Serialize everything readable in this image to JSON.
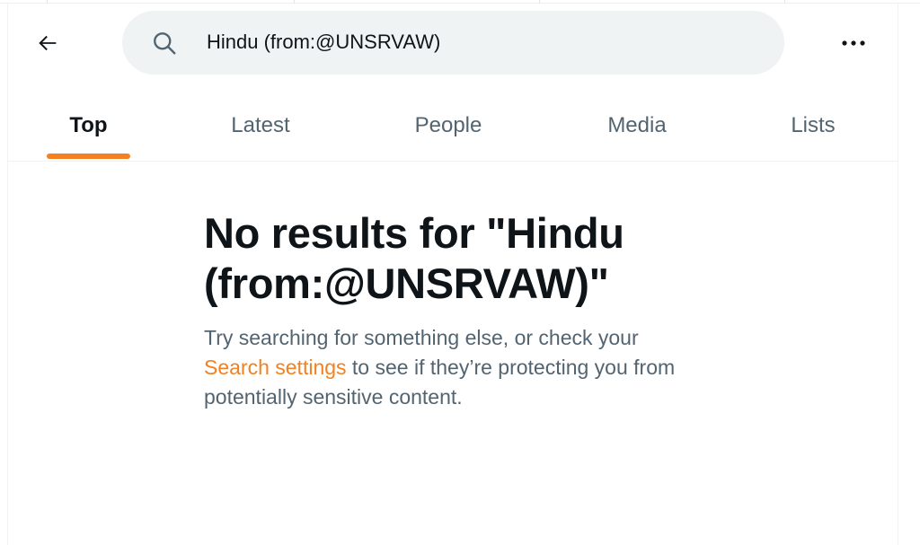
{
  "colors": {
    "accent": "#f4801f",
    "text_primary": "#0f1419",
    "text_secondary": "#536471",
    "search_bg": "#eff3f4"
  },
  "header": {
    "back_icon": "arrow-left-icon",
    "search_icon": "magnifier-icon",
    "search_value": "Hindu (from:@UNSRVAW)",
    "more_icon": "ellipsis-icon"
  },
  "tabs": [
    {
      "label": "Top",
      "active": true
    },
    {
      "label": "Latest",
      "active": false
    },
    {
      "label": "People",
      "active": false
    },
    {
      "label": "Media",
      "active": false
    },
    {
      "label": "Lists",
      "active": false
    }
  ],
  "empty_state": {
    "title": "No results for \"Hindu (from:@UNSRVAW)\"",
    "body_prefix": "Try searching for something else, or check your ",
    "link": "Search settings",
    "body_suffix": " to see if they’re protecting you from potentially sensitive content."
  }
}
